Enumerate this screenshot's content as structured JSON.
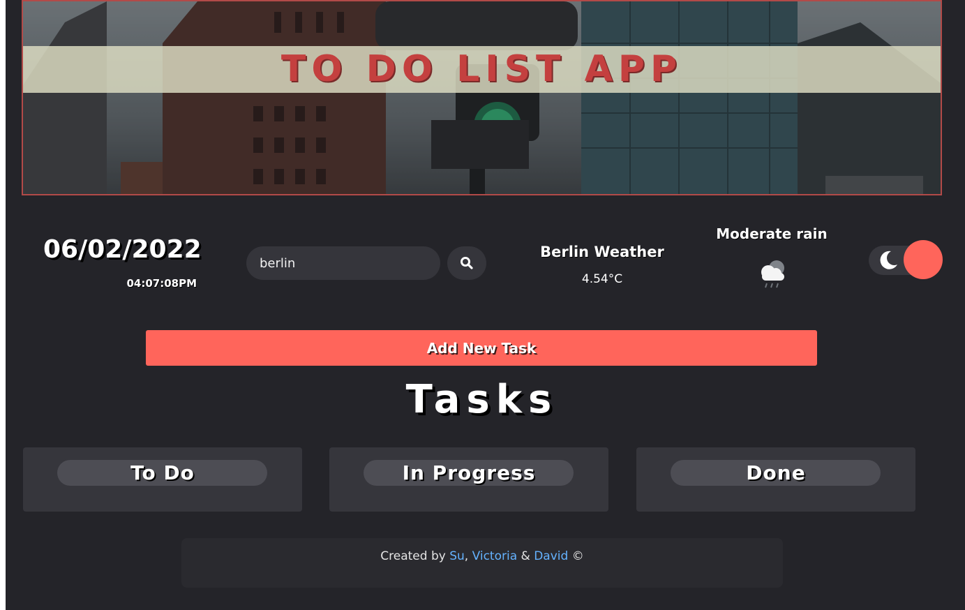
{
  "header": {
    "title": "TO DO LIST APP"
  },
  "datetime": {
    "date": "06/02/2022",
    "time": "04:07:08PM"
  },
  "search": {
    "value": "berlin",
    "icon": "search-icon"
  },
  "weather": {
    "city_title": "Berlin Weather",
    "temperature": "4.54°C",
    "description": "Moderate rain",
    "icon": "rain-cloud-icon"
  },
  "theme_toggle": {
    "icon": "moon-icon",
    "state": "dark"
  },
  "add_task": {
    "label": "Add New Task"
  },
  "tasks": {
    "heading": "Tasks",
    "columns": [
      {
        "label": "To Do"
      },
      {
        "label": "In Progress"
      },
      {
        "label": "Done"
      }
    ]
  },
  "footer": {
    "prefix": "Created by",
    "author1": "Su",
    "sep1": ",",
    "author2": "Victoria",
    "sep2": "&",
    "author3": "David",
    "copyright": "©"
  },
  "colors": {
    "accent": "#ff655b",
    "background": "#242429",
    "title": "#c4403f",
    "link": "#64b2ff"
  }
}
